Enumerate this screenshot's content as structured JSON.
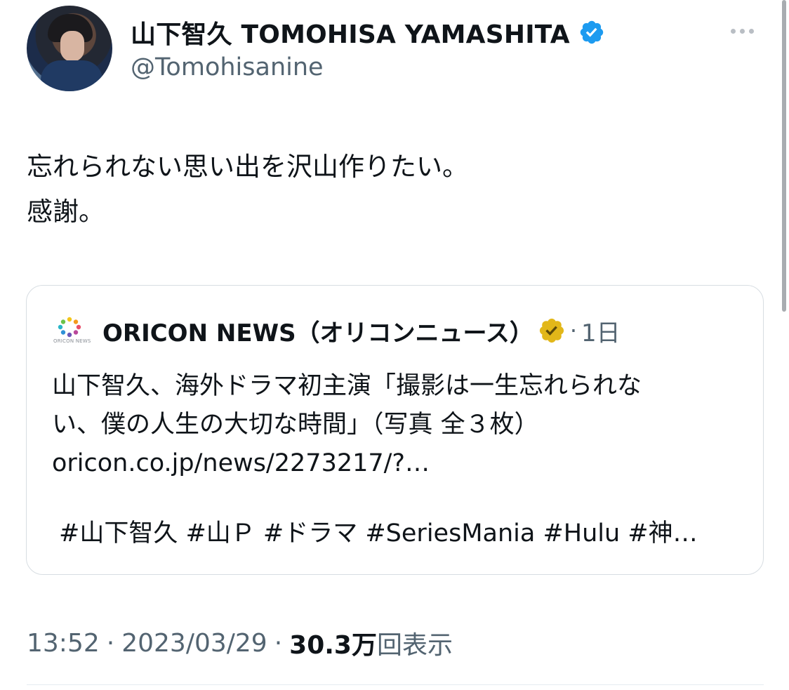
{
  "author": {
    "display_name": "山下智久 TOMOHISA YAMASHITA",
    "handle": "@Tomohisanine",
    "verified_badge_icon": "verified-badge-icon",
    "avatar_icon": "profile-avatar"
  },
  "tweet": {
    "text_lines": [
      "忘れられない思い出を沢山作りたい。",
      "感謝。"
    ]
  },
  "quote": {
    "source_name": "ORICON NEWS（オリコンニュース）",
    "logo_caption": "ORICON NEWS",
    "badge_icon": "gold-verified-badge-icon",
    "separator": "·",
    "time_ago": "1日",
    "body_lines": [
      "山下智久、海外ドラマ初主演「撮影は一生忘れられな",
      "い、僕の人生の大切な時間」（写真 全３枚）",
      "oricon.co.jp/news/2273217/?…"
    ],
    "hashtags": "#山下智久 #山Ｐ #ドラマ #SeriesMania #Hulu #神…"
  },
  "meta": {
    "time": "13:52",
    "separator": "·",
    "date": "2023/03/29",
    "views_count": "30.3万",
    "views_label": "回表示"
  },
  "colors": {
    "text_primary": "#0f1419",
    "text_secondary": "#536471",
    "verified_blue": "#1d9bf0",
    "verified_gold": "#e2b719",
    "border": "#d7dde2"
  }
}
